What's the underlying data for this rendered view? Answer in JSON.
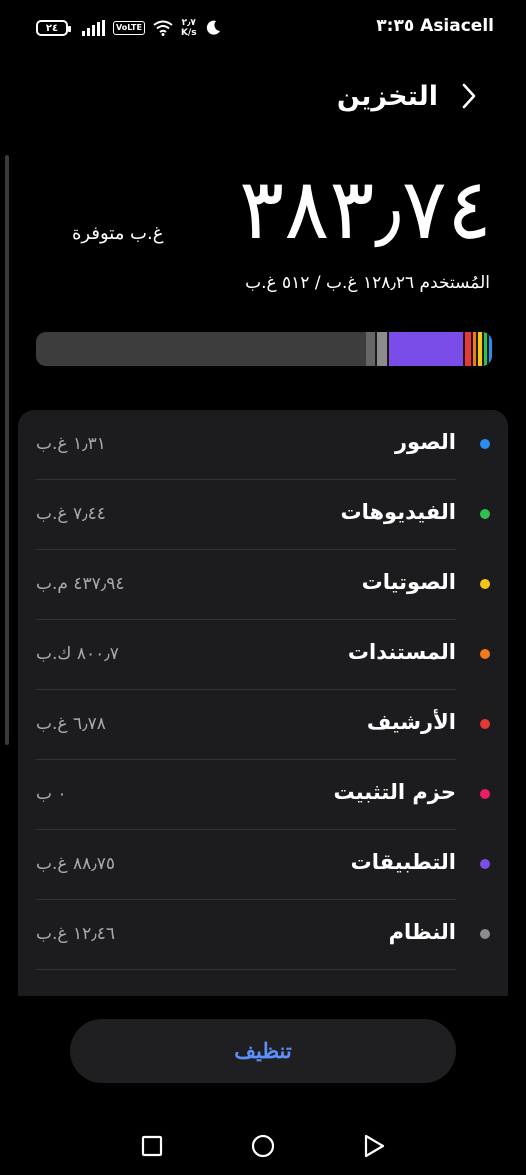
{
  "status_bar": {
    "carrier": "Asiacell",
    "time": "٣:٣٥",
    "battery": "٢٤",
    "volte": "VoLTE",
    "net_speed_value": "٢٫٧",
    "net_speed_unit": "K/s",
    "icons": [
      "battery-icon",
      "signal-icon",
      "volte-icon",
      "wifi-icon",
      "moon-icon"
    ]
  },
  "header": {
    "title": "التخزين",
    "back_icon": "chevron-right-icon"
  },
  "summary": {
    "available_value": "٣٨٣٫٧٤",
    "available_label": "غ.ب متوفرة",
    "usage_text": "المُستخدم ١٢٨٫٢٦ غ.ب / ٥١٢ غ.ب"
  },
  "usage_bar": {
    "segments": [
      {
        "name": "photos",
        "fraction": 0.006,
        "color": "#2b8df0"
      },
      {
        "name": "videos",
        "fraction": 0.012,
        "color": "#2ec050"
      },
      {
        "name": "audio",
        "fraction": 0.012,
        "color": "#f5c518"
      },
      {
        "name": "documents",
        "fraction": 0.012,
        "color": "#f27a1a"
      },
      {
        "name": "archive",
        "fraction": 0.018,
        "color": "#e53935"
      },
      {
        "name": "apps",
        "fraction": 0.167,
        "color": "#7b4de8"
      },
      {
        "name": "system",
        "fraction": 0.026,
        "color": "#8c8c8c"
      },
      {
        "name": "other",
        "fraction": 0.024,
        "color": "#666666"
      }
    ]
  },
  "categories": [
    {
      "name": "الصور",
      "size": "١٫٣١ غ.ب",
      "color": "#2b8df0"
    },
    {
      "name": "الفيديوهات",
      "size": "٧٫٤٤ غ.ب",
      "color": "#2ec050"
    },
    {
      "name": "الصوتيات",
      "size": "٤٣٧٫٩٤ م.ب",
      "color": "#f5c518"
    },
    {
      "name": "المستندات",
      "size": "٨٠٠٫٧ ك.ب",
      "color": "#f27a1a"
    },
    {
      "name": "الأرشيف",
      "size": "٦٫٧٨ غ.ب",
      "color": "#e53935"
    },
    {
      "name": "حزم التثبيت",
      "size": "٠ ب",
      "color": "#e91e63"
    },
    {
      "name": "التطبيقات",
      "size": "٨٨٫٧٥ غ.ب",
      "color": "#7b4de8"
    },
    {
      "name": "النظام",
      "size": "١٢٫٤٦ غ.ب",
      "color": "#8c8c8c"
    }
  ],
  "actions": {
    "clean_label": "تنظيف"
  },
  "nav": {
    "icons": [
      "recents-square-icon",
      "home-circle-icon",
      "back-triangle-icon"
    ]
  }
}
